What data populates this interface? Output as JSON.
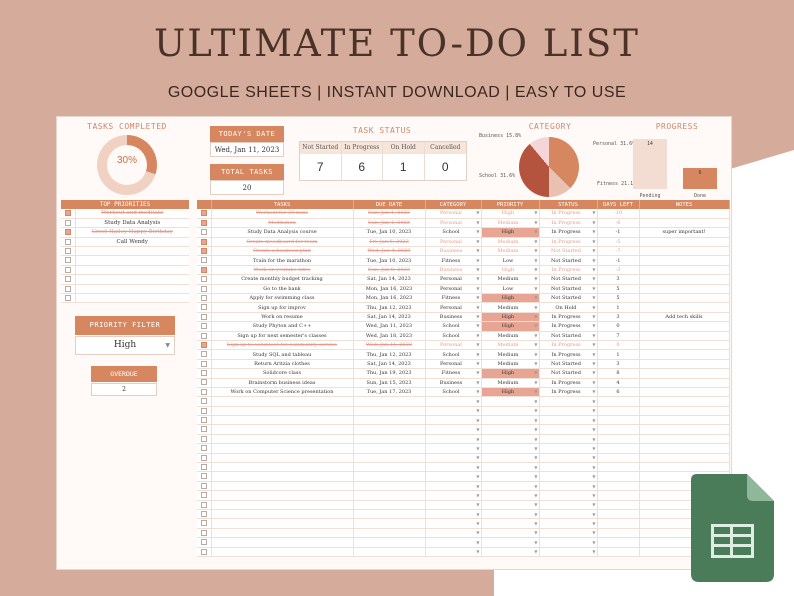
{
  "hero": {
    "title": "ULTIMATE TO-DO LIST",
    "subtitle": "GOOGLE SHEETS | INSTANT DOWNLOAD | EASY TO USE"
  },
  "colors": {
    "accent": "#d6875f",
    "background": "#d5ac9b",
    "highlight": "#e8a593",
    "sheets_green": "#0f9d58"
  },
  "dashboard": {
    "tasks_completed_label": "TASKS COMPLETED",
    "tasks_completed_percent": "30%",
    "todays_date_label": "TODAY'S DATE",
    "todays_date": "Wed, Jan 11, 2023",
    "total_tasks_label": "TOTAL TASKS",
    "total_tasks": "20",
    "task_status_label": "TASK STATUS",
    "status": [
      {
        "name": "Not Started",
        "count": "7"
      },
      {
        "name": "In Progress",
        "count": "6"
      },
      {
        "name": "On Hold",
        "count": "1"
      },
      {
        "name": "Cancelled",
        "count": "0"
      }
    ],
    "category_label": "CATEGORY",
    "progress_label": "PROGRESS"
  },
  "chart_data": [
    {
      "type": "pie",
      "title": "CATEGORY",
      "categories": [
        "Personal",
        "Fitness",
        "School",
        "Business"
      ],
      "values": [
        37.5,
        12.5,
        38.9,
        11.1
      ],
      "labels": [
        "Personal 31.6%",
        "Fitness 21.1%",
        "School 31.6%",
        "Business 15.8%"
      ]
    },
    {
      "type": "bar",
      "title": "PROGRESS",
      "categories": [
        "Pending",
        "Done"
      ],
      "values": [
        14,
        6
      ],
      "ylim": [
        0,
        14
      ]
    }
  ],
  "priorities": {
    "header": "TOP PRIORITIES",
    "items": [
      {
        "text": "Workout and meditate",
        "checked": true
      },
      {
        "text": "Study Data Analysis",
        "checked": false
      },
      {
        "text": "Greet Hailey Happy Birthday",
        "checked": true
      },
      {
        "text": "Call Wendy",
        "checked": false
      },
      {
        "text": "",
        "checked": false
      },
      {
        "text": "",
        "checked": false
      },
      {
        "text": "",
        "checked": false
      },
      {
        "text": "",
        "checked": false
      },
      {
        "text": "",
        "checked": false
      },
      {
        "text": "",
        "checked": false
      }
    ]
  },
  "filter": {
    "label": "PRIORITY FILTER",
    "value": "High"
  },
  "overdue": {
    "label": "OVERDUE",
    "value": "2"
  },
  "tasks": {
    "headers": [
      "",
      "TASKS",
      "DUE DATE",
      "CATEGORY",
      "PRIORITY",
      "STATUS",
      "DAYS LEFT",
      "NOTES"
    ],
    "rows": [
      {
        "done": true,
        "task": "Workout for 20 mins",
        "due": "Sun, Jan 1, 2023",
        "cat": "Personal",
        "prio": "High",
        "status": "In Progress",
        "days": "-10",
        "notes": ""
      },
      {
        "done": true,
        "task": "Meditation",
        "due": "Sun, Jan 1, 2023",
        "cat": "Personal",
        "prio": "Medium",
        "status": "In Progress",
        "days": "-6",
        "notes": ""
      },
      {
        "done": false,
        "task": "Study Data Analysis course",
        "due": "Tue, Jan 10, 2023",
        "cat": "School",
        "prio": "High",
        "status": "In Progress",
        "days": "-1",
        "notes": "super important!"
      },
      {
        "done": true,
        "task": "Create moodboard for room",
        "due": "Fri, Jan 6, 2023",
        "cat": "Personal",
        "prio": "Medium",
        "status": "In Progress",
        "days": "-5",
        "notes": ""
      },
      {
        "done": true,
        "task": "Create a business plan",
        "due": "Wed, Jan 4, 2023",
        "cat": "Business",
        "prio": "Medium",
        "status": "Not Started",
        "days": "-7",
        "notes": ""
      },
      {
        "done": false,
        "task": "Train for the marathon",
        "due": "Tue, Jan 10, 2023",
        "cat": "Fitness",
        "prio": "Low",
        "status": "Not Started",
        "days": "-1",
        "notes": ""
      },
      {
        "done": true,
        "task": "Work on youtube intro",
        "due": "Sun, Jan 8, 2023",
        "cat": "Business",
        "prio": "High",
        "status": "In Progress",
        "days": "-3",
        "notes": ""
      },
      {
        "done": false,
        "task": "Create monthly budget tracking",
        "due": "Sat, Jan 14, 2023",
        "cat": "Personal",
        "prio": "Medium",
        "status": "Not Started",
        "days": "3",
        "notes": ""
      },
      {
        "done": false,
        "task": "Go to the bank",
        "due": "Mon, Jan 16, 2023",
        "cat": "Personal",
        "prio": "Low",
        "status": "Not Started",
        "days": "5",
        "notes": ""
      },
      {
        "done": false,
        "task": "Apply for swimming class",
        "due": "Mon, Jan 16, 2023",
        "cat": "Fitness",
        "prio": "High",
        "status": "Not Started",
        "days": "5",
        "notes": ""
      },
      {
        "done": false,
        "task": "Sign up for improv",
        "due": "Thu, Jan 12, 2023",
        "cat": "Personal",
        "prio": "Medium",
        "status": "On Hold",
        "days": "1",
        "notes": ""
      },
      {
        "done": false,
        "task": "Work on resume",
        "due": "Sat, Jan 14, 2023",
        "cat": "Business",
        "prio": "High",
        "status": "In Progress",
        "days": "3",
        "notes": "Add tech skills"
      },
      {
        "done": false,
        "task": "Study Phyton and C++",
        "due": "Wed, Jan 11, 2023",
        "cat": "School",
        "prio": "High",
        "status": "In Progress",
        "days": "0",
        "notes": ""
      },
      {
        "done": false,
        "task": "Sign up for next semester's classes",
        "due": "Wed, Jan 18, 2023",
        "cat": "School",
        "prio": "Medium",
        "status": "Not Started",
        "days": "7",
        "notes": ""
      },
      {
        "done": true,
        "task": "Sign up to volunteer for community service",
        "due": "Wed, Jan 11, 2023",
        "cat": "Personal",
        "prio": "Medium",
        "status": "In Progress",
        "days": "0",
        "notes": ""
      },
      {
        "done": false,
        "task": "Study SQL and tableau",
        "due": "Thu, Jan 12, 2023",
        "cat": "School",
        "prio": "Medium",
        "status": "In Progress",
        "days": "1",
        "notes": ""
      },
      {
        "done": false,
        "task": "Return Aritzia clothes",
        "due": "Sat, Jan 14, 2023",
        "cat": "Personal",
        "prio": "Medium",
        "status": "Not Started",
        "days": "3",
        "notes": ""
      },
      {
        "done": false,
        "task": "Solidcore class",
        "due": "Thu, Jan 19, 2023",
        "cat": "Fitness",
        "prio": "High",
        "status": "Not Started",
        "days": "8",
        "notes": ""
      },
      {
        "done": false,
        "task": "Brainstorm business ideas",
        "due": "Sun, Jan 15, 2023",
        "cat": "Business",
        "prio": "Medium",
        "status": "In Progress",
        "days": "4",
        "notes": ""
      },
      {
        "done": false,
        "task": "Work on Computer Science presentation",
        "due": "Tue, Jan 17, 2023",
        "cat": "School",
        "prio": "High",
        "status": "In Progress",
        "days": "6",
        "notes": ""
      }
    ],
    "empty_rows": 17
  }
}
